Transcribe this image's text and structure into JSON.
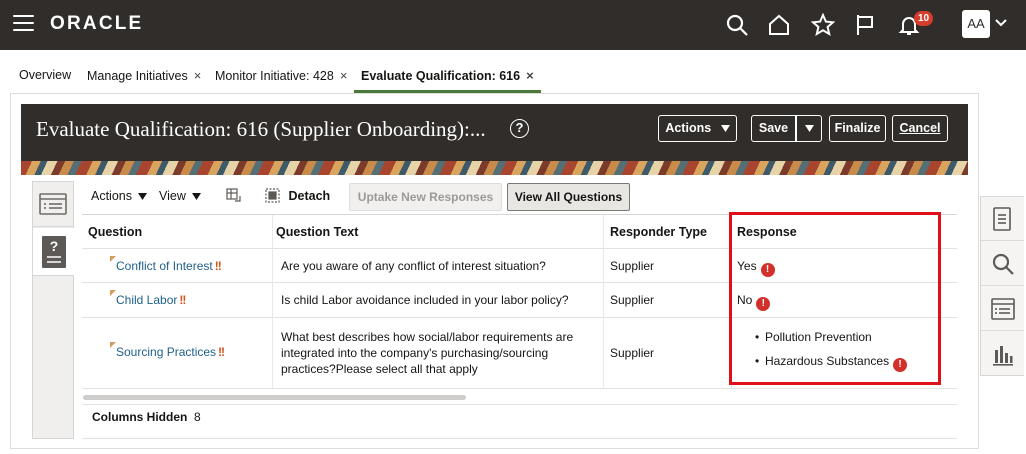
{
  "app": {
    "brand": "ORACLE",
    "notifications_count": "10",
    "avatar_initials": "AA"
  },
  "tabs": [
    {
      "label": "Overview",
      "closable": false
    },
    {
      "label": "Manage Initiatives",
      "closable": true
    },
    {
      "label": "Monitor Initiative: 428",
      "closable": true
    },
    {
      "label": "Evaluate Qualification: 616",
      "closable": true,
      "active": true
    }
  ],
  "tab_close_glyph": "×",
  "page": {
    "title": "Evaluate Qualification: 616 (Supplier Onboarding):...",
    "help_glyph": "?",
    "buttons": {
      "actions": "Actions",
      "save": "Save",
      "finalize": "Finalize",
      "cancel": "Cancel"
    }
  },
  "toolbar": {
    "actions": "Actions",
    "view": "View",
    "detach": "Detach",
    "uptake": "Uptake New Responses",
    "view_all": "View All Questions"
  },
  "table": {
    "headers": {
      "question": "Question",
      "question_text": "Question Text",
      "responder_type": "Responder Type",
      "response": "Response"
    },
    "rows": [
      {
        "question": "Conflict of Interest",
        "text": "Are you aware of any conflict of interest situation?",
        "responder": "Supplier",
        "response": "Yes"
      },
      {
        "question": "Child Labor",
        "text": "Is child Labor avoidance included in your labor policy?",
        "responder": "Supplier",
        "response": "No"
      },
      {
        "question": "Sourcing Practices",
        "text_lines": [
          "What best describes how social/labor requirements are",
          "integrated into the company's purchasing/sourcing",
          "practices?Please select all that apply"
        ],
        "responder": "Supplier",
        "responses": [
          "Pollution Prevention",
          "Hazardous Substances"
        ]
      }
    ],
    "required_glyph": "!!",
    "error_glyph": "!"
  },
  "footer": {
    "columns_hidden_label": "Columns Hidden",
    "columns_hidden_count": "8"
  },
  "colors": {
    "header_bg": "#312d2a",
    "link": "#1f5f8b",
    "highlight": "#e0101a",
    "error": "#d2302a"
  }
}
